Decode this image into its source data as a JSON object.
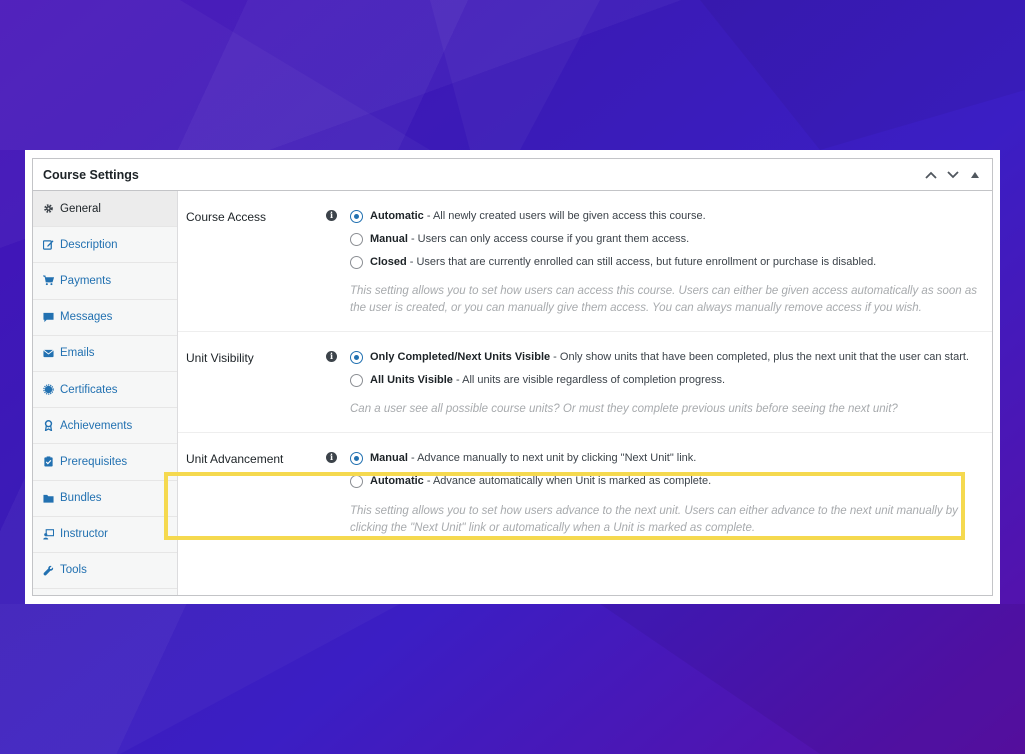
{
  "panel": {
    "title": "Course Settings"
  },
  "sidebar": {
    "items": [
      {
        "label": "General",
        "icon": "gear-icon",
        "active": true
      },
      {
        "label": "Description",
        "icon": "edit-icon",
        "active": false
      },
      {
        "label": "Payments",
        "icon": "cart-icon",
        "active": false
      },
      {
        "label": "Messages",
        "icon": "message-icon",
        "active": false
      },
      {
        "label": "Emails",
        "icon": "email-icon",
        "active": false
      },
      {
        "label": "Certificates",
        "icon": "certificate-icon",
        "active": false
      },
      {
        "label": "Achievements",
        "icon": "award-icon",
        "active": false
      },
      {
        "label": "Prerequisites",
        "icon": "clipboard-icon",
        "active": false
      },
      {
        "label": "Bundles",
        "icon": "folder-icon",
        "active": false
      },
      {
        "label": "Instructor",
        "icon": "instructor-icon",
        "active": false
      },
      {
        "label": "Tools",
        "icon": "wrench-icon",
        "active": false
      }
    ]
  },
  "sections": {
    "course_access": {
      "label": "Course Access",
      "options": [
        {
          "title": "Automatic",
          "text": " - All newly created users will be given access this course.",
          "checked": true
        },
        {
          "title": "Manual",
          "text": " - Users can only access course if you grant them access.",
          "checked": false
        },
        {
          "title": "Closed",
          "text": " - Users that are currently enrolled can still access, but future enrollment or purchase is disabled.",
          "checked": false
        }
      ],
      "description": "This setting allows you to set how users can access this course. Users can either be given access automatically as soon as the user is created, or you can manually give them access. You can always manually remove access if you wish."
    },
    "unit_visibility": {
      "label": "Unit Visibility",
      "options": [
        {
          "title": "Only Completed/Next Units Visible",
          "text": " - Only show units that have been completed, plus the next unit that the user can start.",
          "checked": true
        },
        {
          "title": "All Units Visible",
          "text": " - All units are visible regardless of completion progress.",
          "checked": false
        }
      ],
      "description": "Can a user see all possible course units? Or must they complete previous units before seeing the next unit?"
    },
    "unit_advancement": {
      "label": "Unit Advancement",
      "options": [
        {
          "title": "Manual",
          "text": " - Advance manually to next unit by clicking \"Next Unit\" link.",
          "checked": true
        },
        {
          "title": "Automatic",
          "text": " - Advance automatically when Unit is marked as complete.",
          "checked": false
        }
      ],
      "description": "This setting allows you to set how users advance to the next unit. Users can either advance to the next unit manually by clicking the \"Next Unit\" link or automatically when a Unit is marked as complete."
    }
  },
  "colors": {
    "accent": "#2271b1",
    "highlight": "#f5d94f",
    "background_from": "#4512b8",
    "background_to": "#5a0fa6"
  }
}
